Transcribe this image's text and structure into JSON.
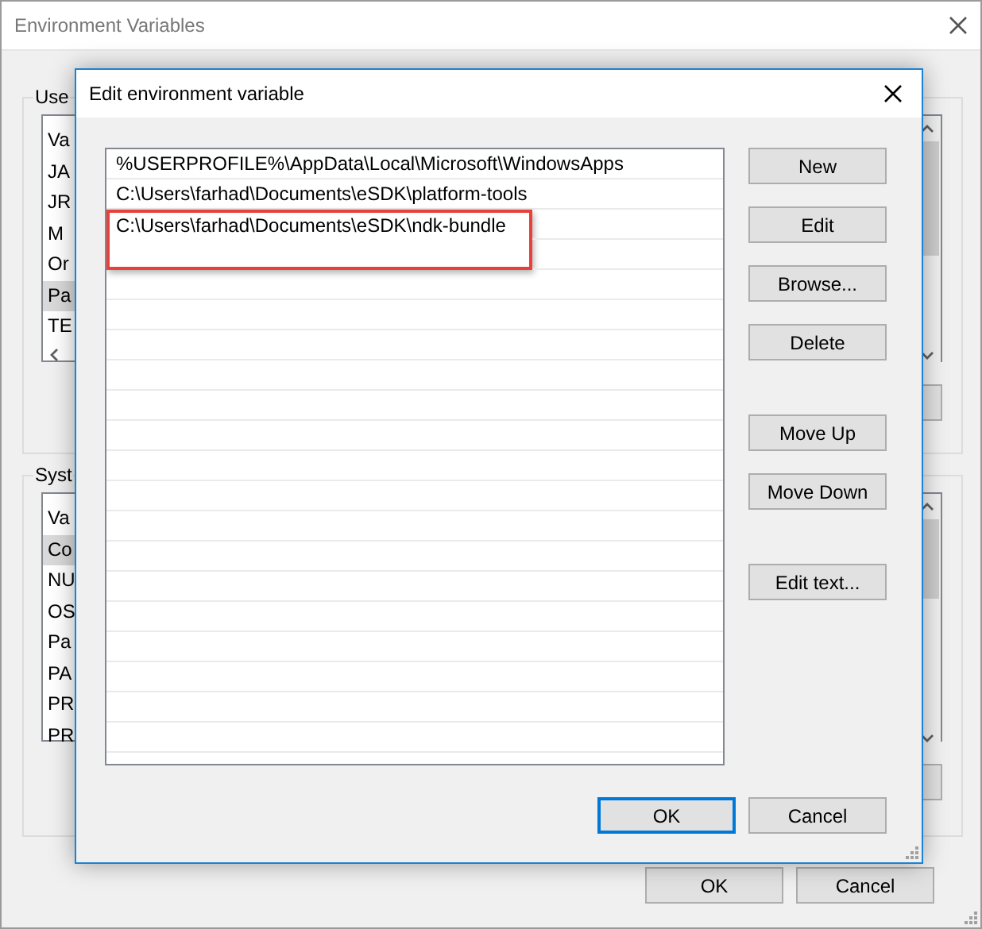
{
  "window": {
    "title": "Environment Variables"
  },
  "user_group": {
    "label": "Use",
    "rows": [
      {
        "text": "Va",
        "selected": false
      },
      {
        "text": "JA",
        "selected": false
      },
      {
        "text": "JR",
        "selected": false
      },
      {
        "text": "M",
        "selected": false
      },
      {
        "text": "Or",
        "selected": false
      },
      {
        "text": "Pa",
        "selected": true
      },
      {
        "text": "TE",
        "selected": false
      }
    ]
  },
  "system_group": {
    "label": "Syst",
    "rows": [
      {
        "text": "Va",
        "selected": false
      },
      {
        "text": "Co",
        "selected": true
      },
      {
        "text": "NU",
        "selected": false
      },
      {
        "text": "OS",
        "selected": false
      },
      {
        "text": "Pa",
        "selected": false
      },
      {
        "text": "PA",
        "selected": false
      },
      {
        "text": "PR",
        "selected": false
      },
      {
        "text": "PR",
        "selected": false
      }
    ]
  },
  "footer_buttons": [
    {
      "label": "OK",
      "default": false
    },
    {
      "label": "Cancel",
      "default": false
    }
  ],
  "dialog": {
    "title": "Edit environment variable",
    "entries": [
      {
        "text": "%USERPROFILE%\\AppData\\Local\\Microsoft\\WindowsApps",
        "outlined": false
      },
      {
        "text": "C:\\Users\\farhad\\Documents\\eSDK\\platform-tools",
        "outlined": false
      },
      {
        "text": "C:\\Users\\farhad\\Documents\\eSDK\\ndk-bundle",
        "outlined": true
      }
    ],
    "button_groups": [
      [
        "New",
        "Edit",
        "Browse...",
        "Delete"
      ],
      [
        "Move Up",
        "Move Down"
      ],
      [
        "Edit text..."
      ]
    ],
    "footer_buttons": [
      {
        "label": "OK",
        "default": true
      },
      {
        "label": "Cancel",
        "default": false
      }
    ]
  }
}
